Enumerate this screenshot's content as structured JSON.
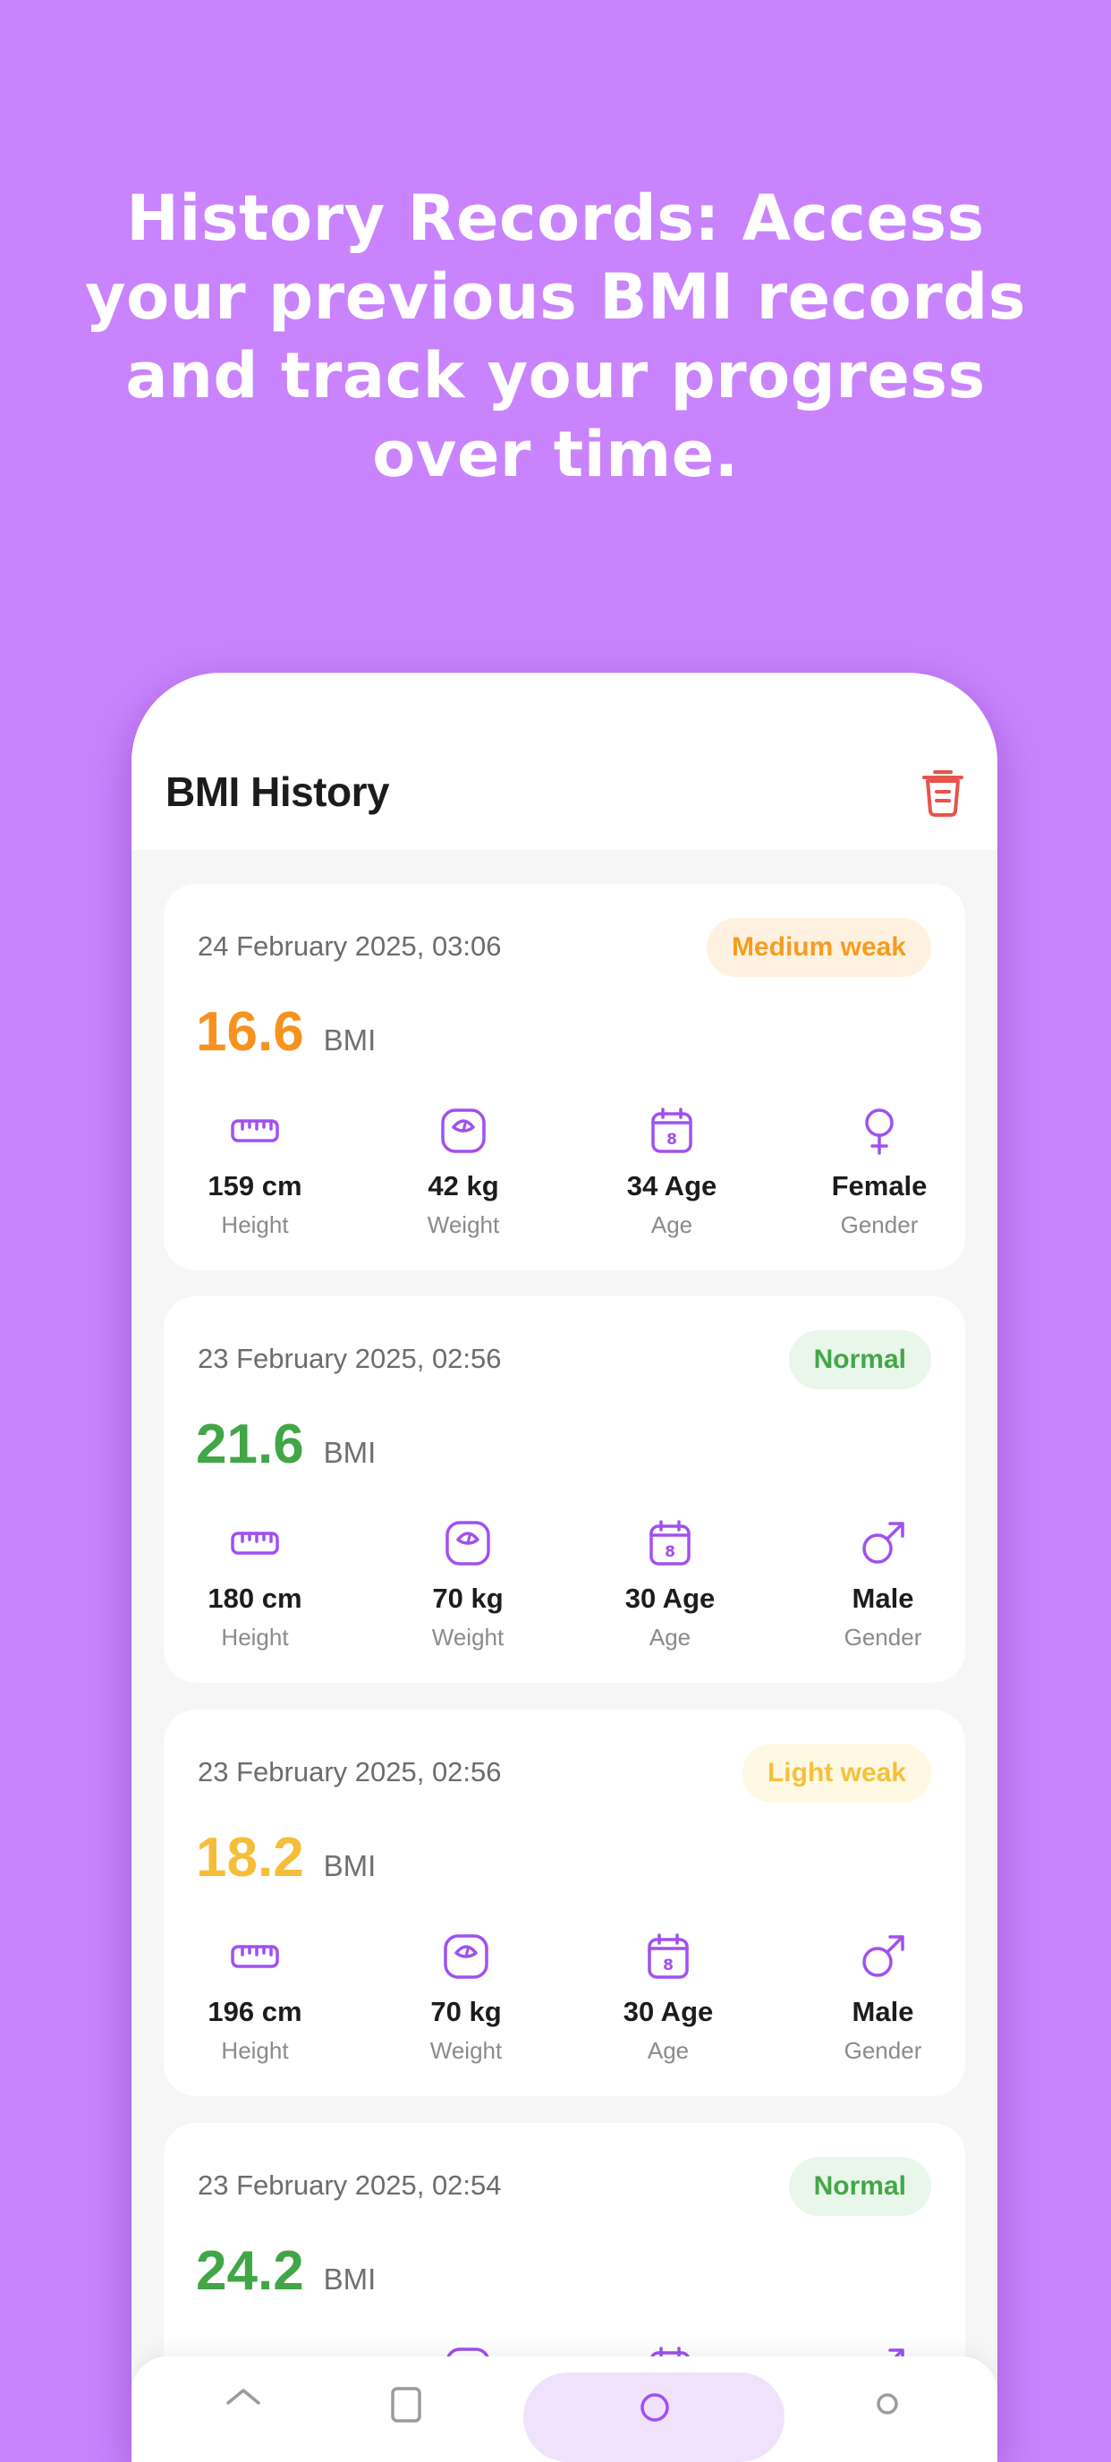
{
  "headline": [
    "History Records: Access",
    "your previous BMI records",
    "and track your progress",
    "over time."
  ],
  "app": {
    "title": "BMI History",
    "trash_icon": "trash-icon"
  },
  "colors": {
    "background": "#c883fd",
    "accent_purple": "#a050f0",
    "orange": "#f7921e",
    "green": "#41a646",
    "yellow": "#f5be3a"
  },
  "stat_labels": {
    "height": "Height",
    "weight": "Weight",
    "age": "Age",
    "gender": "Gender"
  },
  "records": [
    {
      "date": "24 February 2025, 03:06",
      "status": "Medium weak",
      "bmi": "16.6",
      "bmi_unit": "BMI",
      "height": "159 cm",
      "weight": "42 kg",
      "age": "34 Age",
      "gender": "Female"
    },
    {
      "date": "23 February 2025, 02:56",
      "status": "Normal",
      "bmi": "21.6",
      "bmi_unit": "BMI",
      "height": "180 cm",
      "weight": "70 kg",
      "age": "30 Age",
      "gender": "Male"
    },
    {
      "date": "23 February 2025, 02:56",
      "status": "Light weak",
      "bmi": "18.2",
      "bmi_unit": "BMI",
      "height": "196 cm",
      "weight": "70 kg",
      "age": "30 Age",
      "gender": "Male"
    },
    {
      "date": "23 February 2025, 02:54",
      "status": "Normal",
      "bmi": "24.2",
      "bmi_unit": "BMI"
    }
  ]
}
